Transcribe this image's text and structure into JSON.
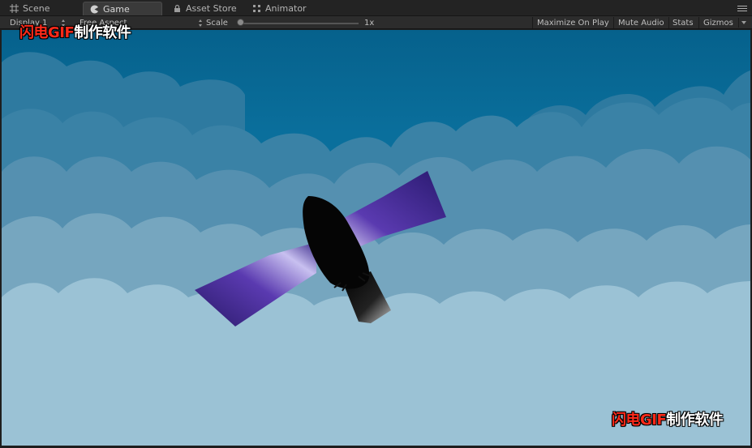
{
  "tabs": [
    {
      "label": "Scene",
      "icon": "grid-icon"
    },
    {
      "label": "Game",
      "icon": "pacman-icon"
    },
    {
      "label": "Asset Store",
      "icon": "lock-icon"
    },
    {
      "label": "Animator",
      "icon": "animator-icon"
    }
  ],
  "controls": {
    "display": "Display 1",
    "aspect": "Free Aspect",
    "scale_label": "Scale",
    "scale_value": "1x",
    "scale_fraction": 0.0,
    "maximize_on_play": "Maximize On Play",
    "mute_audio": "Mute Audio",
    "stats": "Stats",
    "gizmos": "Gizmos"
  },
  "watermarks": [
    {
      "red": "闪电GIF",
      "white": "制作软件"
    },
    {
      "red": "闪电GIF",
      "white": "制作软件"
    }
  ],
  "colors": {
    "sky_top": "#066d9a",
    "cloud_far": "#2f7ea2",
    "cloud_mid": "#4d8eae",
    "cloud_near": "#7aa9c0",
    "cloud_front": "#99c0d3",
    "wing_purple": "#4a2d9a",
    "bird_body": "#050505"
  }
}
